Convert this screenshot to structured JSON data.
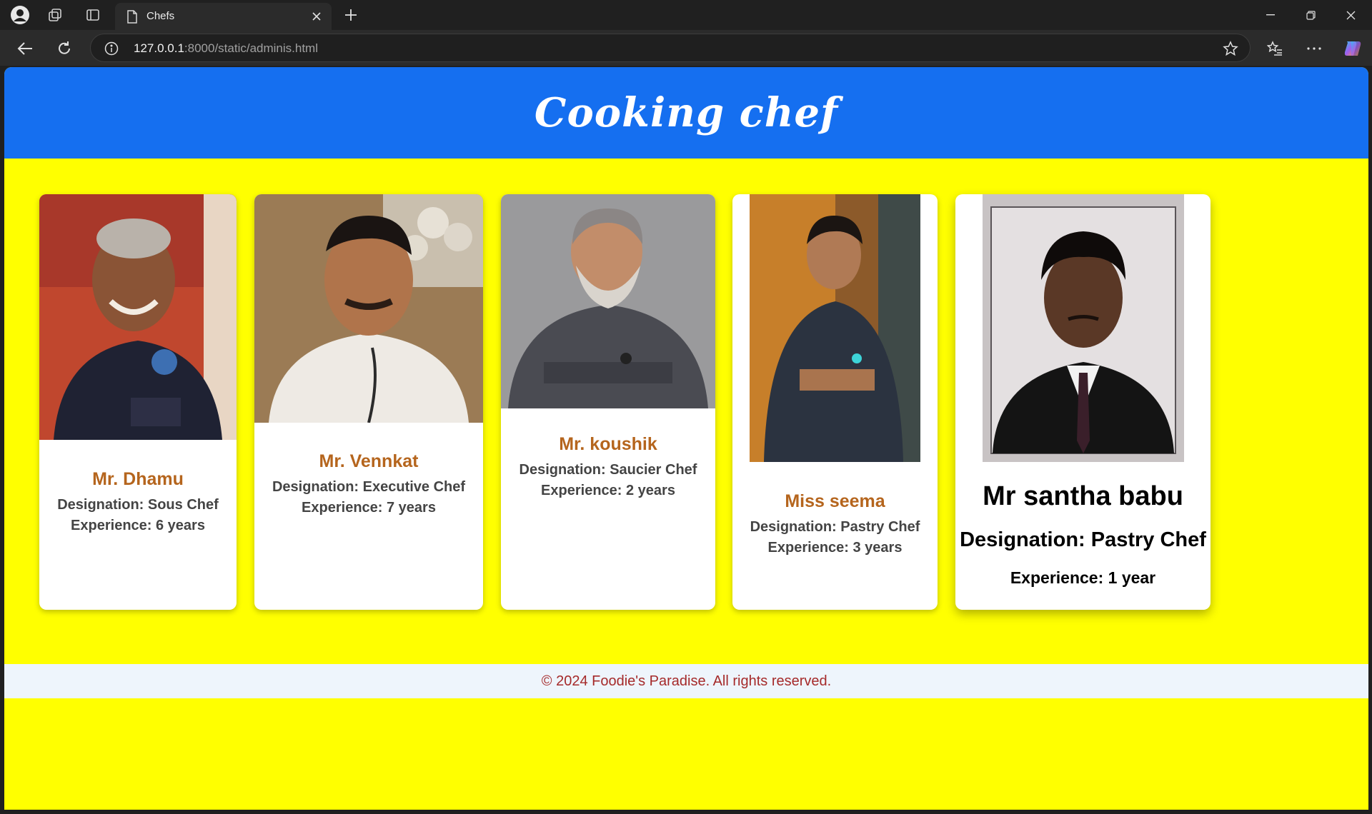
{
  "browser": {
    "tab_title": "Chefs",
    "url_host": "127.0.0.1",
    "url_rest": ":8000/static/adminis.html"
  },
  "page": {
    "title": "Cooking chef",
    "footer": "© 2024 Foodie's Paradise. All rights reserved."
  },
  "chefs": [
    {
      "name": "Mr. Dhamu",
      "designation": "Designation: Sous Chef",
      "experience": "Experience: 6 years"
    },
    {
      "name": "Mr. Vennkat",
      "designation": "Designation: Executive Chef",
      "experience": "Experience: 7 years"
    },
    {
      "name": "Mr. koushik",
      "designation": "Designation: Saucier Chef",
      "experience": "Experience: 2 years"
    },
    {
      "name": "Miss seema",
      "designation": "Designation: Pastry Chef",
      "experience": "Experience: 3 years"
    },
    {
      "name": "Mr santha babu",
      "designation": "Designation: Pastry Chef",
      "experience": "Experience: 1 year"
    }
  ],
  "colors": {
    "header_bg": "#156ff0",
    "page_bg": "#ffff00",
    "name_color": "#b5651d",
    "footer_text": "#a52a2a"
  }
}
